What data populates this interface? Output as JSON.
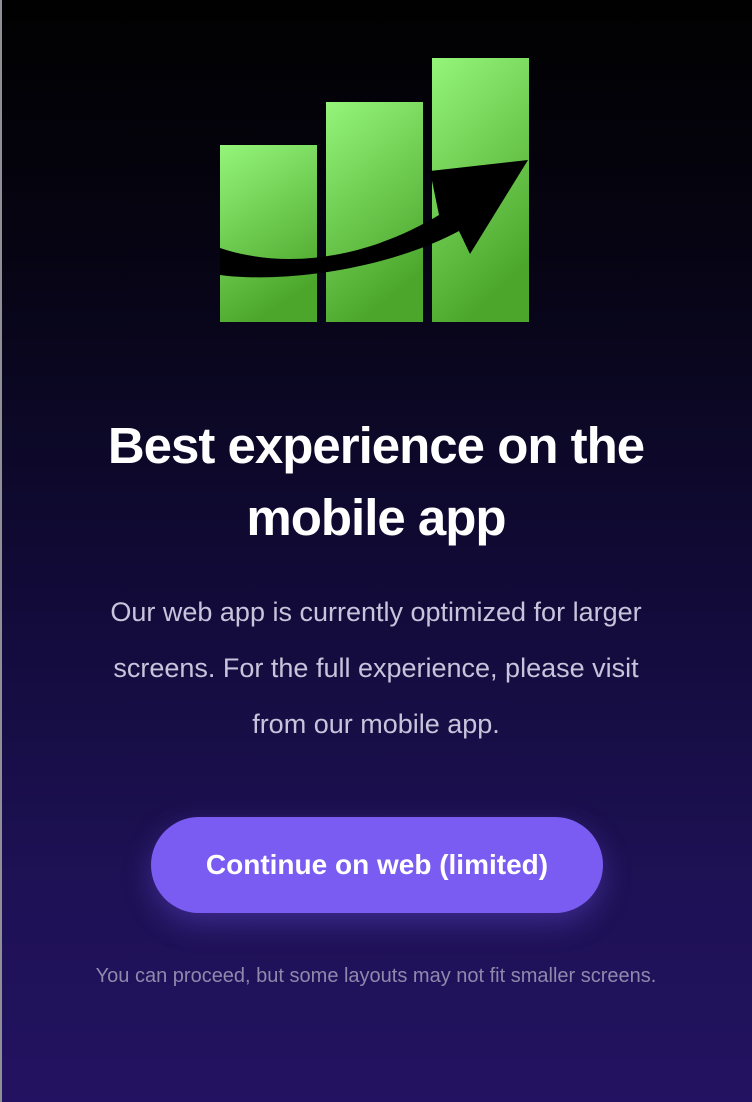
{
  "hero": {
    "logo_icon": "growth-chart-icon",
    "logo_colors": {
      "bar_light": "#94f57a",
      "bar_dark": "#4ca62c",
      "arrow": "#000000"
    }
  },
  "message": {
    "title": "Best experience on the mobile app",
    "body": "Our web app is currently optimized for larger screens. For the full experience, please visit from our mobile app."
  },
  "actions": {
    "continue_label": "Continue on web (limited)",
    "button_color": "#7b5cf2"
  },
  "footnote": "You can proceed, but some layouts may not fit smaller screens."
}
